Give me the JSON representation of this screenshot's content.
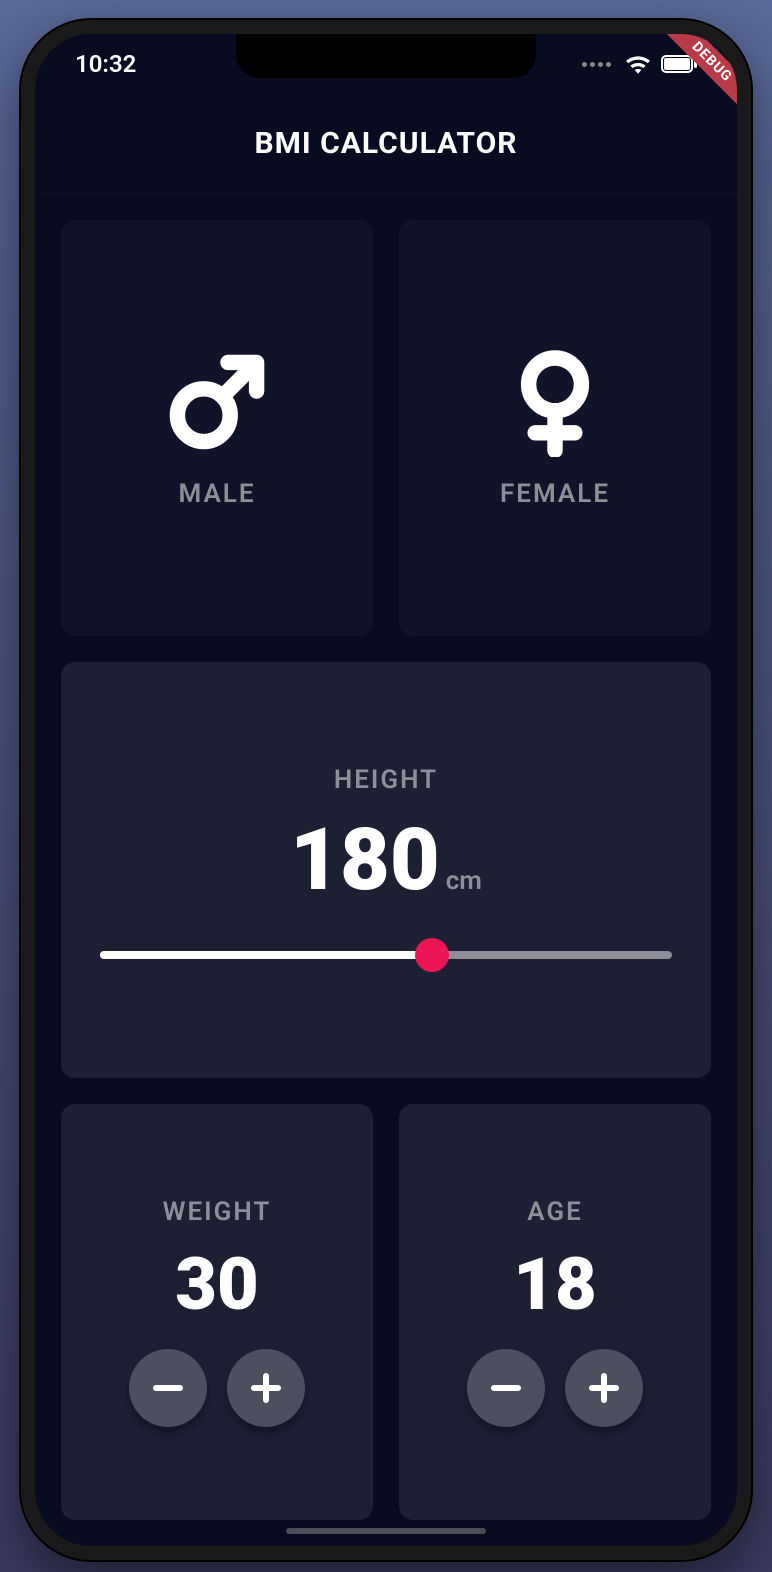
{
  "statusBar": {
    "time": "10:32"
  },
  "debugBanner": "DEBUG",
  "appBar": {
    "title": "BMI CALCULATOR"
  },
  "gender": {
    "male": {
      "label": "MALE"
    },
    "female": {
      "label": "FEMALE"
    }
  },
  "height": {
    "label": "HEIGHT",
    "value": "180",
    "unit": "cm",
    "min": 120,
    "max": 220,
    "percent": 58
  },
  "weight": {
    "label": "WEIGHT",
    "value": "30"
  },
  "age": {
    "label": "AGE",
    "value": "18"
  },
  "colors": {
    "background": "#090c20",
    "card": "#1d1f33",
    "cardInactive": "#111428",
    "labelText": "#8d8e98",
    "accent": "#eb1555",
    "buttonBg": "#4c4f5e"
  }
}
